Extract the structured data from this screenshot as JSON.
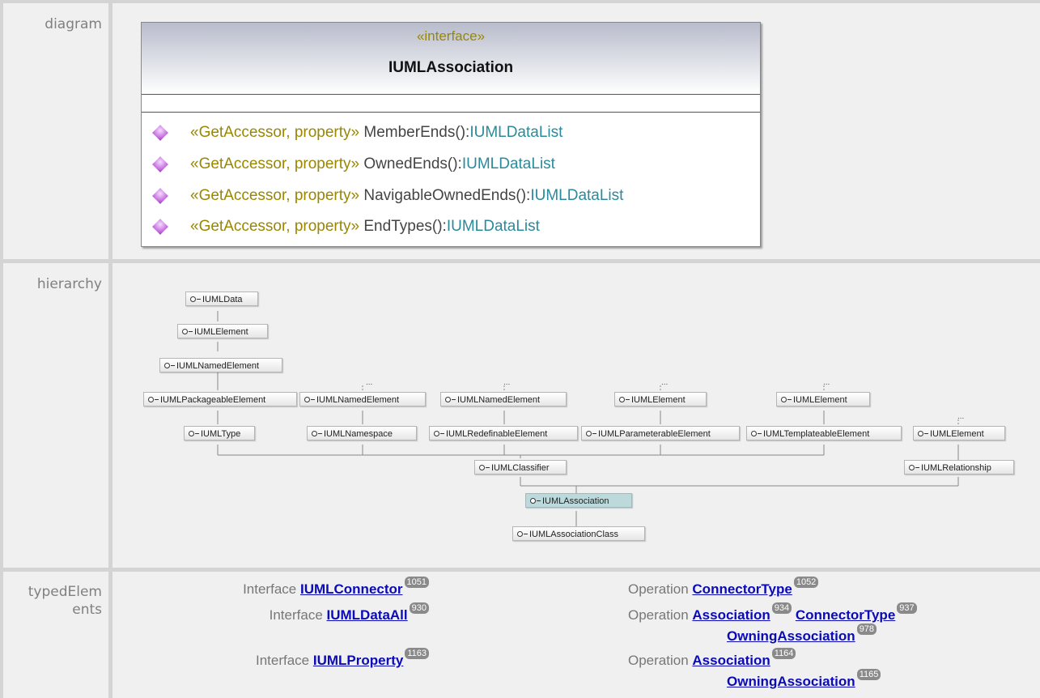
{
  "sections": {
    "diagram": "diagram",
    "hierarchy": "hierarchy",
    "typed_elements_1": "typedElem",
    "typed_elements_2": "ents"
  },
  "interface": {
    "stereotype": "«interface»",
    "name": "IUMLAssociation",
    "operations": [
      {
        "stereo": "«GetAccessor, property»",
        "name": " MemberEnds():",
        "type": "IUMLDataList"
      },
      {
        "stereo": "«GetAccessor, property»",
        "name": " OwnedEnds():",
        "type": "IUMLDataList"
      },
      {
        "stereo": "«GetAccessor, property»",
        "name": " NavigableOwnedEnds():",
        "type": "IUMLDataList"
      },
      {
        "stereo": "«GetAccessor, property»",
        "name": " EndTypes():",
        "type": "IUMLDataList"
      }
    ]
  },
  "hierarchy": {
    "nodes": {
      "data": "IUMLData",
      "element_top": "IUMLElement",
      "named_element_top": "IUMLNamedElement",
      "packageable": "IUMLPackageableElement",
      "named_element_2": "IUMLNamedElement",
      "named_element_3": "IUMLNamedElement",
      "element_2": "IUMLElement",
      "element_3": "IUMLElement",
      "type": "IUMLType",
      "namespace": "IUMLNamespace",
      "redefinable": "IUMLRedefinableElement",
      "parameterable": "IUMLParameterableElement",
      "templateable": "IUMLTemplateableElement",
      "element_4": "IUMLElement",
      "classifier": "IUMLClassifier",
      "relationship": "IUMLRelationship",
      "association": "IUMLAssociation",
      "association_class": "IUMLAssociationClass"
    },
    "ellipsis": "..."
  },
  "typed_elements": {
    "left": [
      {
        "kind": "Interface",
        "link": "IUMLConnector",
        "badge": "1051"
      },
      {
        "kind": "Interface",
        "link": "IUMLDataAll",
        "badge": "930"
      },
      {
        "kind": "Interface",
        "link": "IUMLProperty",
        "badge": "1163"
      }
    ],
    "right": [
      {
        "kind": "Operation",
        "links": [
          {
            "text": "ConnectorType",
            "badge": "1052"
          }
        ]
      },
      {
        "kind": "Operation",
        "links": [
          {
            "text": "Association",
            "badge": "934"
          },
          {
            "text": "ConnectorType",
            "badge": "937"
          },
          {
            "text": "OwningAssociation",
            "badge": "978"
          }
        ]
      },
      {
        "kind": "Operation",
        "links": [
          {
            "text": "Association",
            "badge": "1164"
          },
          {
            "text": "OwningAssociation",
            "badge": "1165"
          }
        ]
      }
    ]
  },
  "colors": {
    "stereotype": "#9a8700",
    "type": "#2b8a9a",
    "link": "#0a0ab8",
    "selected_node": "#bcd9dc"
  }
}
